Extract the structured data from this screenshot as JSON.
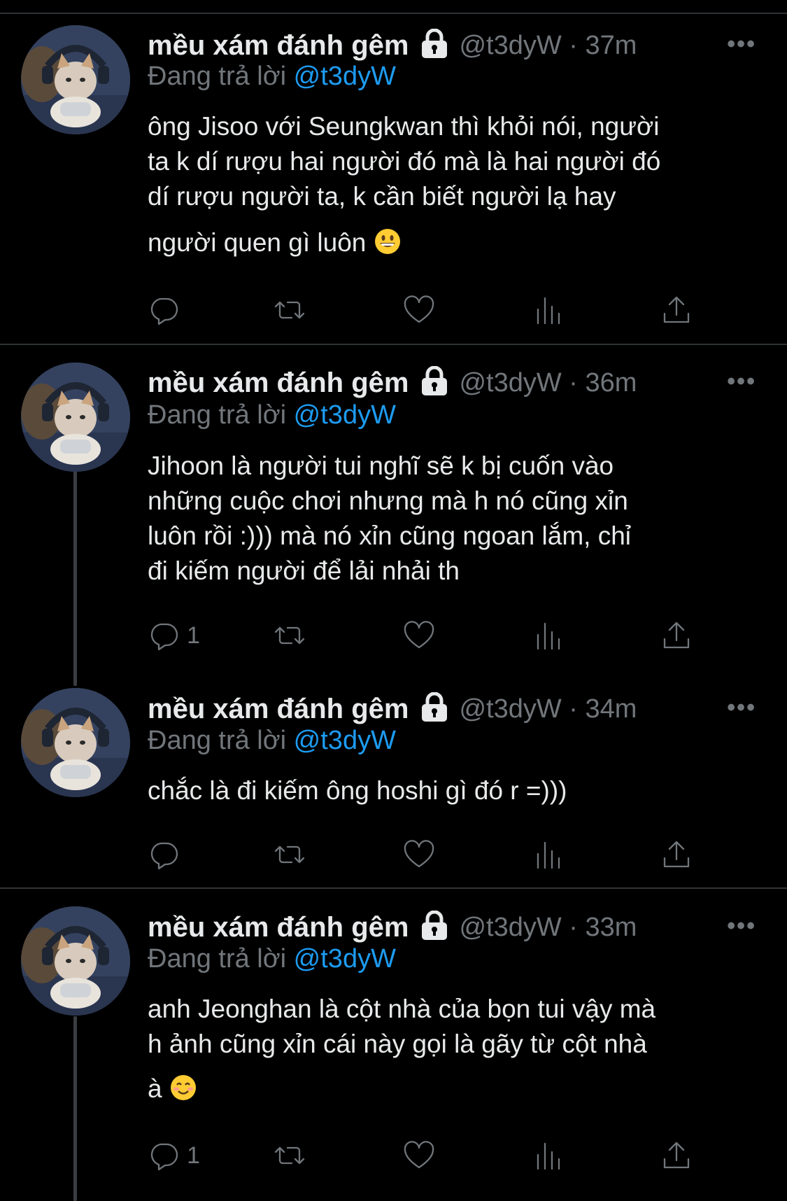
{
  "colors": {
    "background": "#000000",
    "text": "#e7e9ea",
    "muted": "#71767b",
    "link": "#1d9bf0",
    "divider": "#2f3336"
  },
  "icons": {
    "reply": "reply-icon",
    "retweet": "retweet-icon",
    "like": "heart-icon",
    "views": "views-icon",
    "share": "share-icon",
    "lock": "lock-icon",
    "more": "more-icon"
  },
  "tweets": [
    {
      "author_name": "mều xám đánh gêm",
      "handle_time": "@t3dyW · 37m",
      "replying_label": "Đang trả lời",
      "replying_to": "@t3dyW",
      "lines": [
        "ông Jisoo với Seungkwan thì khỏi nói, người",
        "ta k dí rượu hai người đó mà là hai người đó",
        "dí rượu người ta, k cần biết người lạ hay",
        "người quen gì luôn"
      ],
      "emoji": "grinning-face",
      "reply_count": ""
    },
    {
      "author_name": "mều xám đánh gêm",
      "handle_time": "@t3dyW · 36m",
      "replying_label": "Đang trả lời",
      "replying_to": "@t3dyW",
      "lines": [
        "Jihoon là người tui nghĩ sẽ k bị cuốn vào",
        "những cuộc chơi nhưng mà h nó cũng xỉn",
        "luôn rồi :))) mà nó xỉn cũng ngoan lắm, chỉ",
        "đi kiếm người để lải nhải th"
      ],
      "reply_count": "1"
    },
    {
      "author_name": "mều xám đánh gêm",
      "handle_time": "@t3dyW · 34m",
      "replying_label": "Đang trả lời",
      "replying_to": "@t3dyW",
      "lines": [
        "chắc là đi kiếm ông hoshi gì đó r =)))"
      ],
      "reply_count": ""
    },
    {
      "author_name": "mều xám đánh gêm",
      "handle_time": "@t3dyW · 33m",
      "replying_label": "Đang trả lời",
      "replying_to": "@t3dyW",
      "lines": [
        "anh Jeonghan là cột nhà của bọn tui vậy mà",
        "h ảnh cũng xỉn cái này gọi là gãy từ cột nhà",
        "à"
      ],
      "emoji": "smiling-face",
      "reply_count": "1"
    }
  ]
}
